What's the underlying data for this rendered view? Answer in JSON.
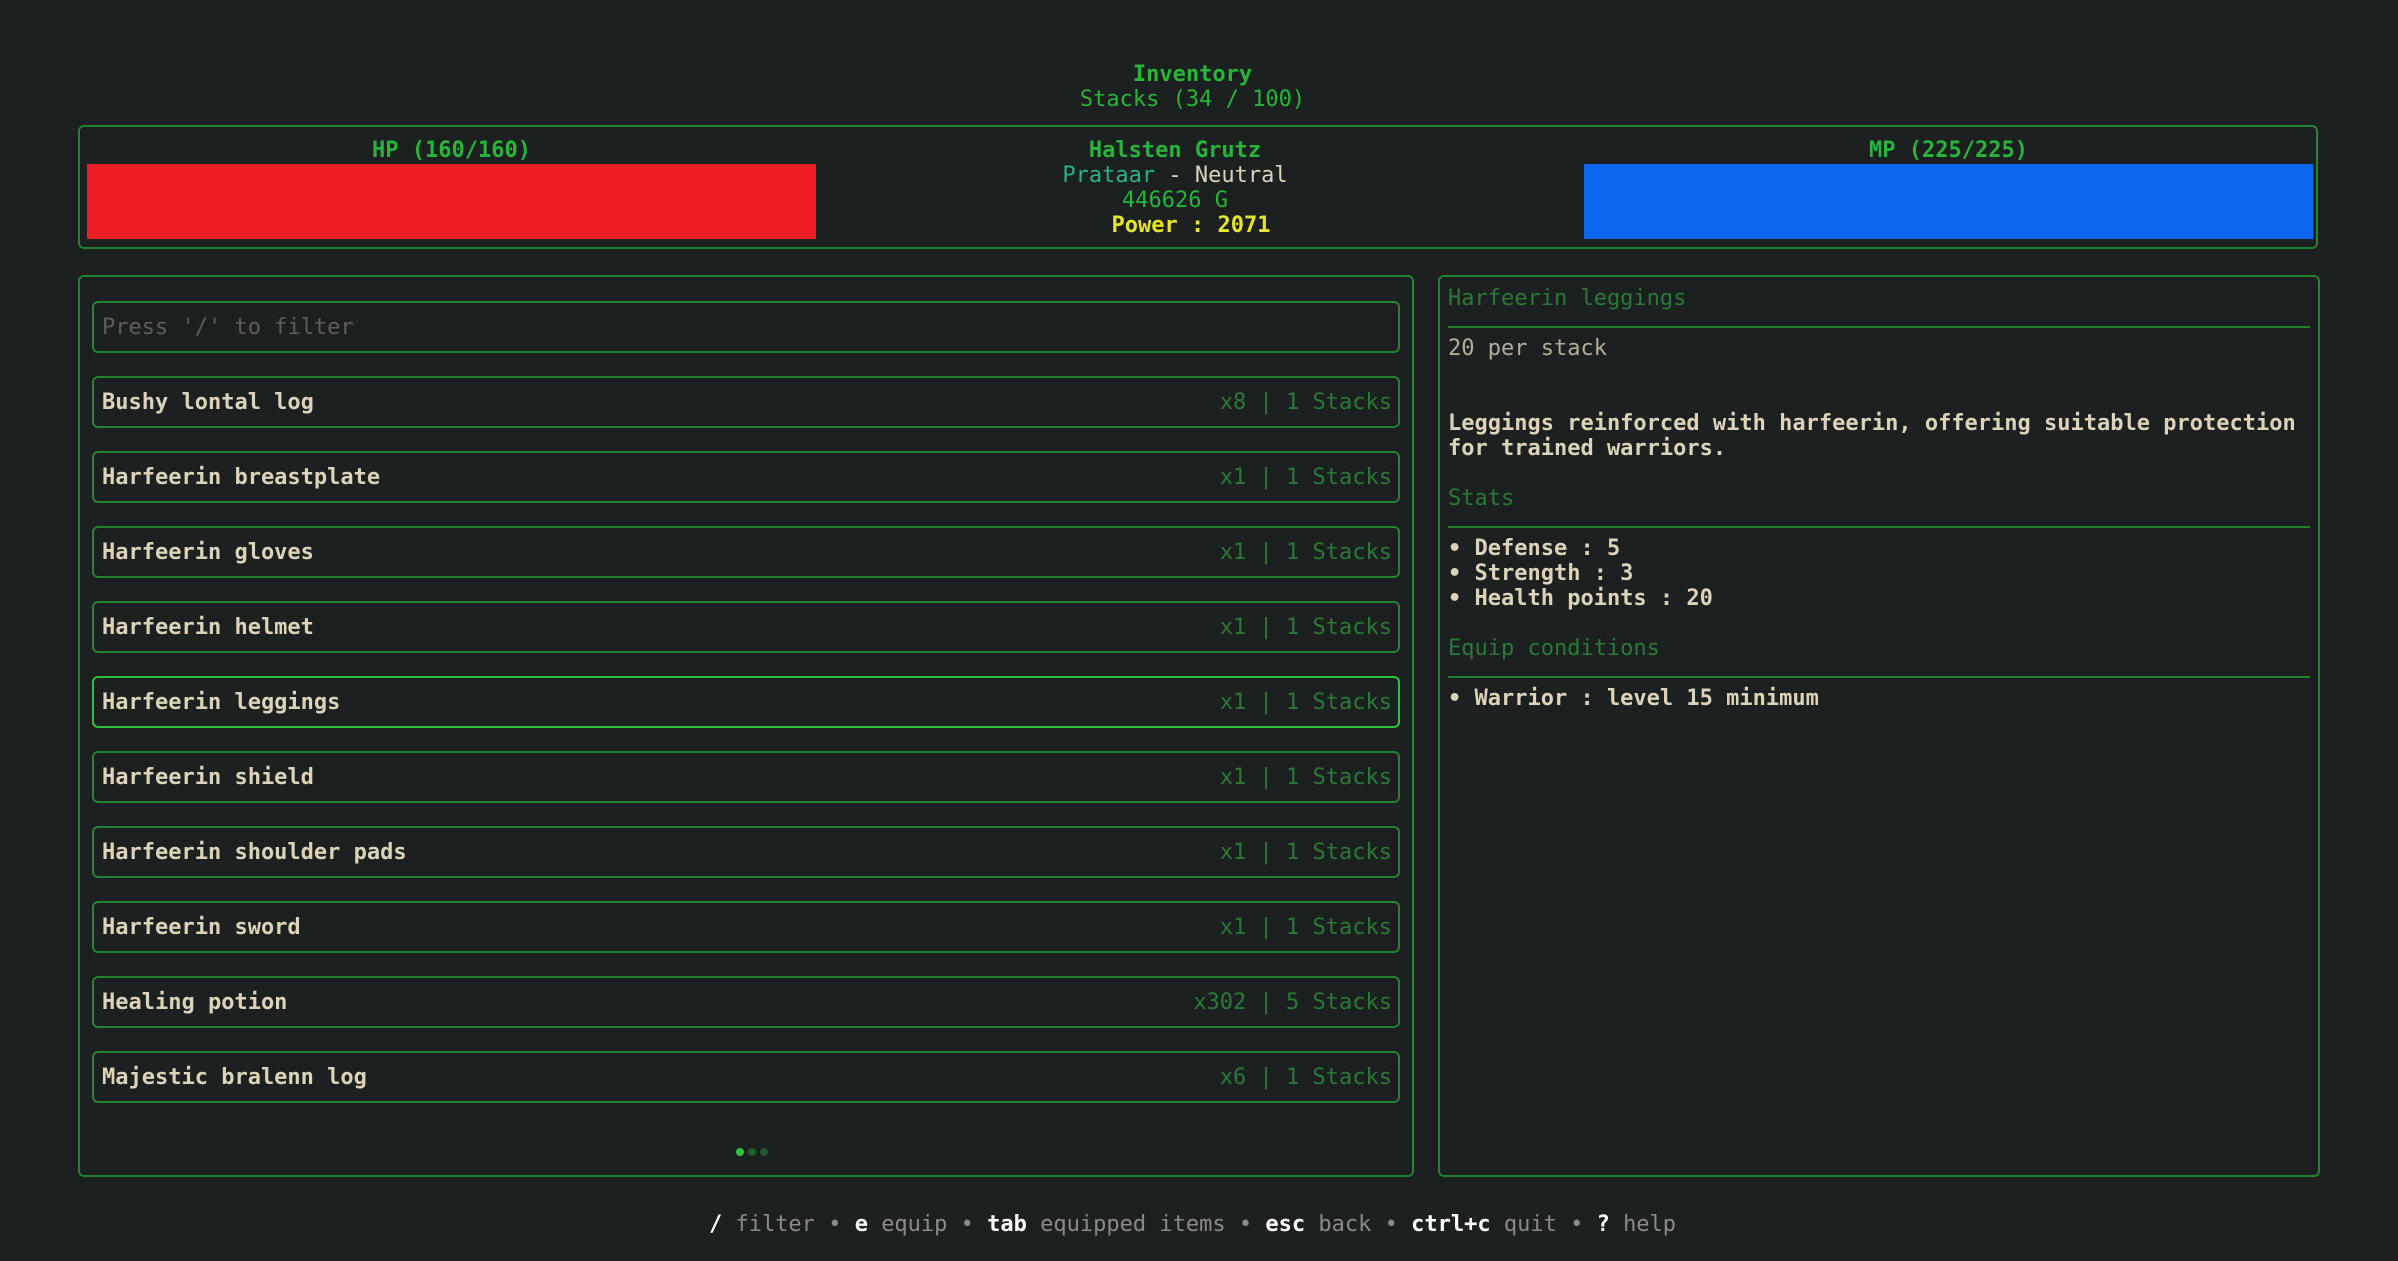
{
  "header": {
    "title": "Inventory",
    "stacks": "Stacks (34 / 100)"
  },
  "status": {
    "hp_label": "HP (160/160)",
    "hp_fraction": 1.0,
    "hp_color": "#ed1f24",
    "mp_label": "MP (225/225)",
    "mp_fraction": 1.0,
    "mp_color": "#0d68ef",
    "name": "Halsten Grutz",
    "race": "Prataar",
    "race_separator": " - ",
    "alignment": "Neutral",
    "gold": "446626 G",
    "power": "Power : 2071"
  },
  "filter": {
    "placeholder": "Press '/' to filter"
  },
  "items": [
    {
      "name": "Bushy lontal log",
      "qty": "x8 | 1 Stacks"
    },
    {
      "name": "Harfeerin breastplate",
      "qty": "x1 | 1 Stacks"
    },
    {
      "name": "Harfeerin gloves",
      "qty": "x1 | 1 Stacks"
    },
    {
      "name": "Harfeerin helmet",
      "qty": "x1 | 1 Stacks"
    },
    {
      "name": "Harfeerin leggings",
      "qty": "x1 | 1 Stacks"
    },
    {
      "name": "Harfeerin shield",
      "qty": "x1 | 1 Stacks"
    },
    {
      "name": "Harfeerin shoulder pads",
      "qty": "x1 | 1 Stacks"
    },
    {
      "name": "Harfeerin sword",
      "qty": "x1 | 1 Stacks"
    },
    {
      "name": "Healing potion",
      "qty": "x302 | 5 Stacks"
    },
    {
      "name": "Majestic bralenn log",
      "qty": "x6 | 1 Stacks"
    }
  ],
  "selected_index": 4,
  "pager": {
    "pages": 3,
    "current": 1
  },
  "detail": {
    "title": "Harfeerin leggings",
    "per_stack": "20 per stack",
    "description": "Leggings reinforced with harfeerin, offering suitable protection for trained warriors.",
    "stats_heading": "Stats",
    "stats": [
      "• Defense : 5",
      "• Strength : 3",
      "• Health points : 20"
    ],
    "conditions_heading": "Equip conditions",
    "conditions": [
      "• Warrior : level 15 minimum"
    ]
  },
  "help": {
    "filter_key": "/",
    "filter_label": "filter",
    "equip_key": "e",
    "equip_label": "equip",
    "tab_key": "tab",
    "tab_label": "equipped items",
    "esc_key": "esc",
    "esc_label": "back",
    "quit_key": "ctrl+c",
    "quit_label": "quit",
    "help_key": "?",
    "help_label": "help",
    "separator": "•"
  },
  "colors": {
    "accent": "#27b53a",
    "border": "#24832f",
    "background": "#1d2021",
    "power": "#e5e52a"
  }
}
